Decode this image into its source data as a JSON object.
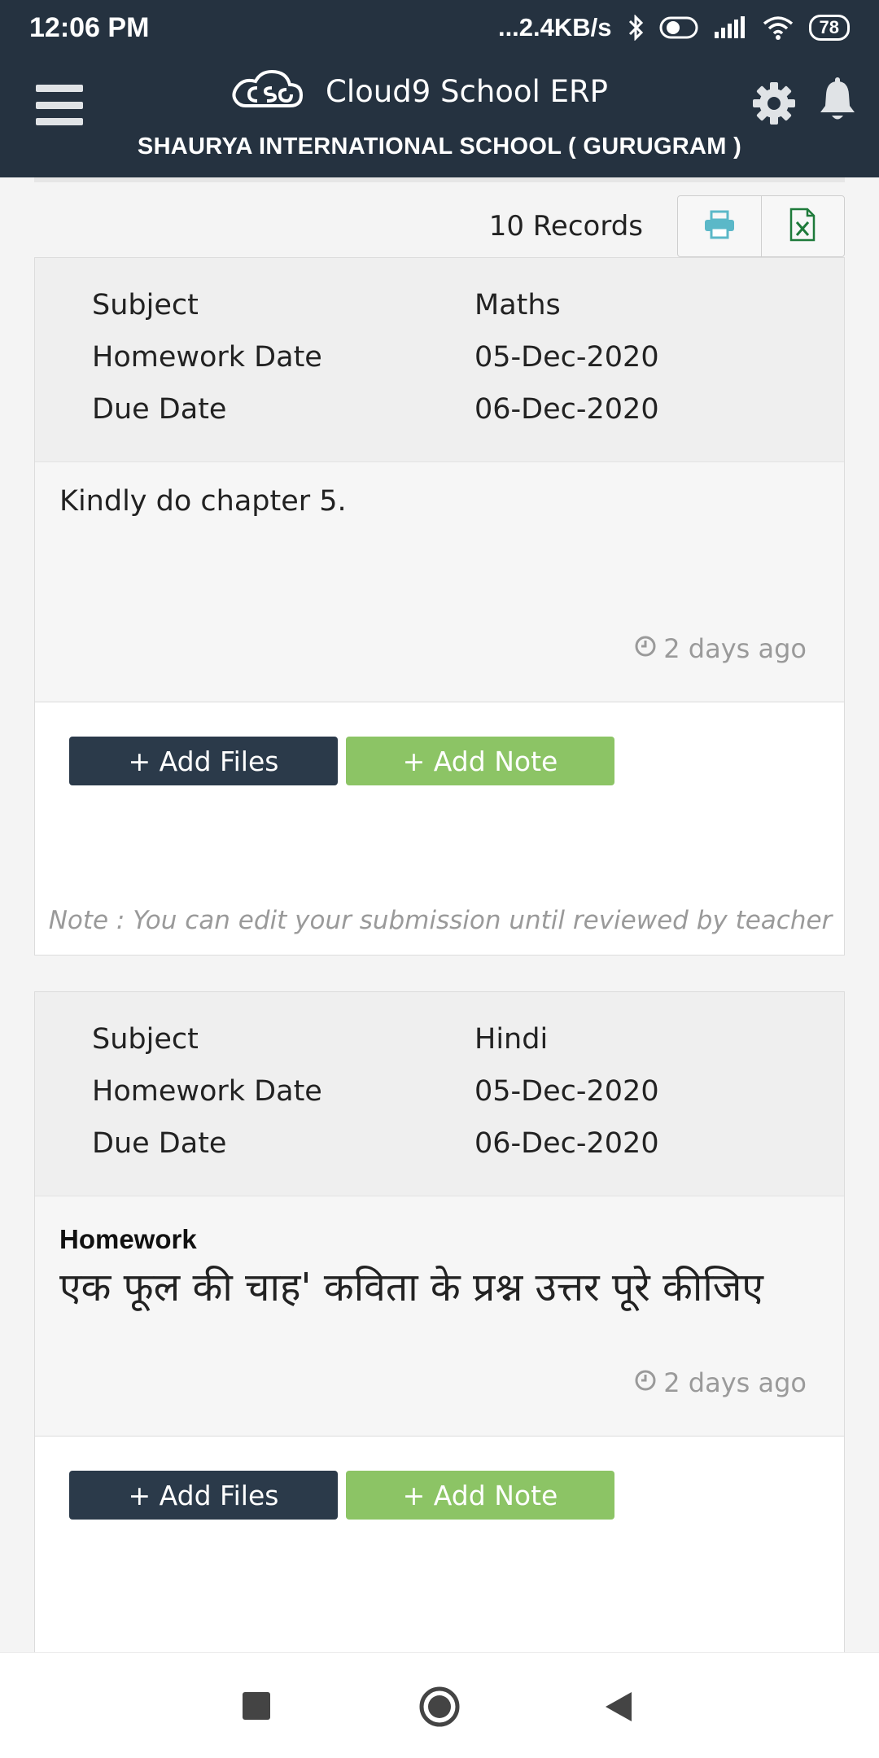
{
  "status_bar": {
    "time": "12:06 PM",
    "network_speed": "...2.4KB/s",
    "battery": "78"
  },
  "app_bar": {
    "title": "Cloud9 School ERP",
    "school_name": "SHAURYA INTERNATIONAL SCHOOL ( GURUGRAM )"
  },
  "toolbar": {
    "records_label": "10 Records"
  },
  "homework": [
    {
      "subject_label": "Subject",
      "subject": "Maths",
      "homework_date_label": "Homework Date",
      "homework_date": "05-Dec-2020",
      "due_date_label": "Due Date",
      "due_date": "06-Dec-2020",
      "description": "Kindly do chapter 5.",
      "time_ago": "2 days ago",
      "add_files_label": "+ Add Files",
      "add_note_label": "+ Add Note",
      "note": "Note : You can edit your submission until reviewed by teacher"
    },
    {
      "subject_label": "Subject",
      "subject": "Hindi",
      "homework_date_label": "Homework Date",
      "homework_date": "05-Dec-2020",
      "due_date_label": "Due Date",
      "due_date": "06-Dec-2020",
      "description_heading": "Homework",
      "description": "एक फूल की चाह' कविता के प्रश्न उत्तर पूरे कीजिए",
      "time_ago": "2 days ago",
      "add_files_label": "+ Add Files",
      "add_note_label": "+ Add Note"
    }
  ],
  "colors": {
    "header_bg": "#253240",
    "add_files_bg": "#2b3a4a",
    "add_note_bg": "#8cc465",
    "print_icon": "#5bb8c8",
    "excel_icon": "#1e7a3a"
  }
}
